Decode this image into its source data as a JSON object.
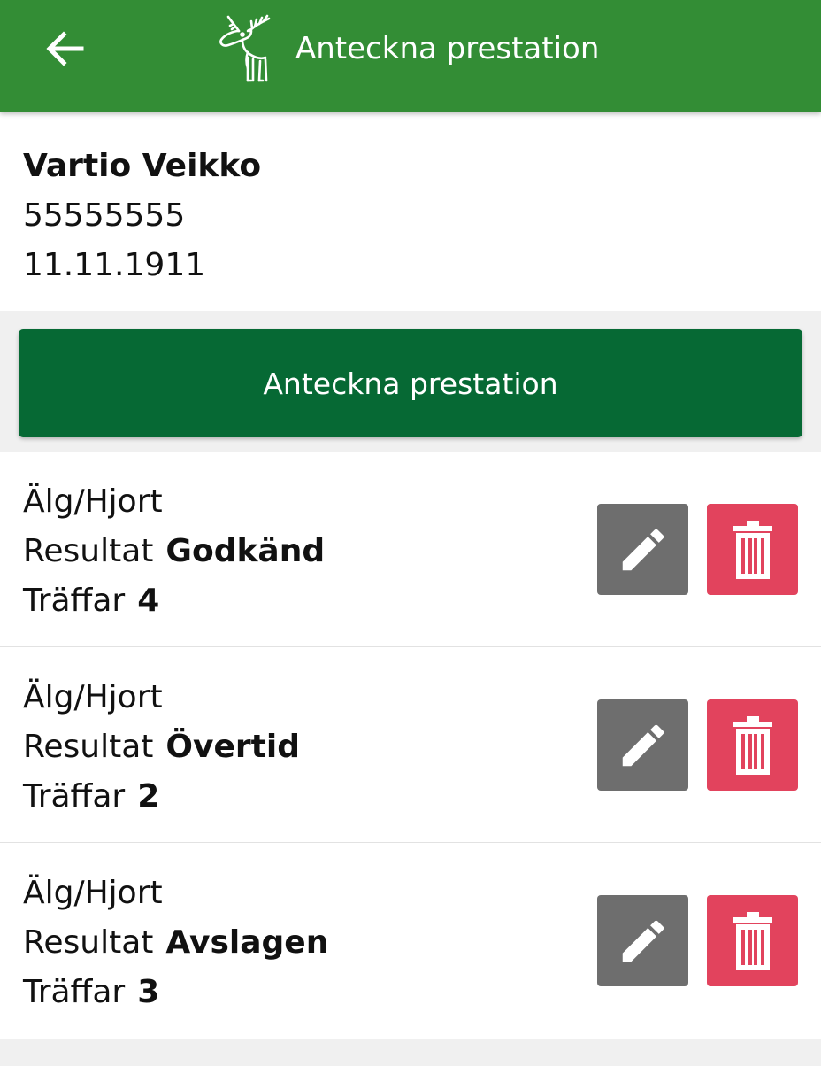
{
  "appbar": {
    "title": "Anteckna prestation",
    "color": "#338d35"
  },
  "person": {
    "name": "Vartio Veikko",
    "id": "55555555",
    "date": "11.11.1911"
  },
  "main_button": {
    "label": "Anteckna prestation",
    "color": "#066934"
  },
  "records": [
    {
      "type": "Älg/Hjort",
      "result_label": "Resultat",
      "result": "Godkänd",
      "hits_label": "Träffar",
      "hits": "4"
    },
    {
      "type": "Älg/Hjort",
      "result_label": "Resultat",
      "result": "Övertid",
      "hits_label": "Träffar",
      "hits": "2"
    },
    {
      "type": "Älg/Hjort",
      "result_label": "Resultat",
      "result": "Avslagen",
      "hits_label": "Träffar",
      "hits": "3"
    }
  ],
  "icons": {
    "back": "arrow-left-icon",
    "logo": "moose-logo-icon",
    "edit": "pencil-icon",
    "delete": "trash-icon"
  },
  "colors": {
    "edit_button": "#6e6e6e",
    "delete_button": "#e2435d"
  }
}
